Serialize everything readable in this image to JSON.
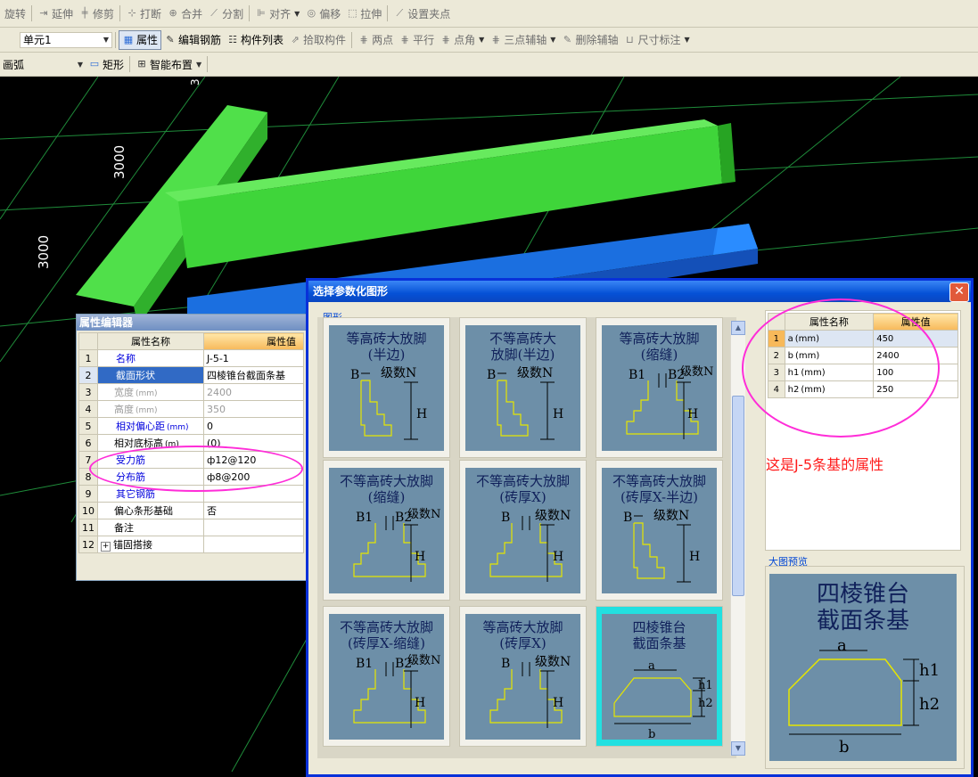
{
  "toolbar1": [
    {
      "label": "旋转",
      "icon": "rotate-icon"
    },
    {
      "label": "延伸",
      "icon": "extend-icon"
    },
    {
      "label": "修剪",
      "icon": "trim-icon"
    },
    {
      "label": "打断",
      "icon": "break-icon"
    },
    {
      "label": "合并",
      "icon": "merge-icon"
    },
    {
      "label": "分割",
      "icon": "split-icon"
    },
    {
      "label": "对齐",
      "icon": "align-icon"
    },
    {
      "label": "偏移",
      "icon": "offset-icon"
    },
    {
      "label": "拉伸",
      "icon": "stretch-icon"
    },
    {
      "label": "设置夹点",
      "icon": "grip-icon"
    }
  ],
  "toolbar2": {
    "unit_combo": "单元1",
    "items": [
      {
        "label": "属性",
        "icon": "properties-icon"
      },
      {
        "label": "编辑钢筋",
        "icon": "edit-rebar-icon"
      },
      {
        "label": "构件列表",
        "icon": "component-list-icon"
      },
      {
        "label": "拾取构件",
        "icon": "pick-component-icon"
      },
      {
        "label": "两点",
        "icon": "two-point-icon"
      },
      {
        "label": "平行",
        "icon": "parallel-icon"
      },
      {
        "label": "点角",
        "icon": "point-angle-icon"
      },
      {
        "label": "三点辅轴",
        "icon": "three-point-axis-icon"
      },
      {
        "label": "删除辅轴",
        "icon": "delete-axis-icon"
      },
      {
        "label": "尺寸标注",
        "icon": "dimension-icon"
      }
    ]
  },
  "toolbar3": {
    "arc_combo": "画弧",
    "rect": "矩形",
    "smart": "智能布置"
  },
  "scene": {
    "dim_top": "3000",
    "dim_left": "3000",
    "dim_edge": "3"
  },
  "prop_editor": {
    "title": "属性编辑器",
    "col_name": "属性名称",
    "col_value": "属性值",
    "rows": [
      {
        "n": "1",
        "name": "名称",
        "value": "J-5-1"
      },
      {
        "n": "2",
        "name": "截面形状",
        "value": "四棱锥台截面条基"
      },
      {
        "n": "3",
        "name": "宽度",
        "unit": "(mm)",
        "value": "2400"
      },
      {
        "n": "4",
        "name": "高度",
        "unit": "(mm)",
        "value": "350"
      },
      {
        "n": "5",
        "name": "相对偏心距",
        "unit": "(mm)",
        "value": "0"
      },
      {
        "n": "6",
        "name": "相对底标高",
        "unit": "(m)",
        "value": "(0)"
      },
      {
        "n": "7",
        "name": "受力筋",
        "value": "ф12@120"
      },
      {
        "n": "8",
        "name": "分布筋",
        "value": "ф8@200"
      },
      {
        "n": "9",
        "name": "其它钢筋",
        "value": ""
      },
      {
        "n": "10",
        "name": "偏心条形基础",
        "value": "否"
      },
      {
        "n": "11",
        "name": "备注",
        "value": ""
      },
      {
        "n": "12",
        "name": "锚固搭接",
        "value": "",
        "expand": "+"
      }
    ]
  },
  "dialog": {
    "title": "选择参数化图形",
    "close": "✕",
    "group_shapes": "图形",
    "group_preview": "大图预览",
    "annotation": "这是J-5条基的属性",
    "col_name": "属性名称",
    "col_value": "属性值",
    "params": [
      {
        "n": "1",
        "name": "a",
        "unit": "(mm)",
        "value": "450"
      },
      {
        "n": "2",
        "name": "b",
        "unit": "(mm)",
        "value": "2400"
      },
      {
        "n": "3",
        "name": "h1",
        "unit": "(mm)",
        "value": "100"
      },
      {
        "n": "4",
        "name": "h2",
        "unit": "(mm)",
        "value": "250"
      }
    ],
    "tiles": [
      {
        "title": "等高砖大放脚\n(半边)",
        "labels": [
          "B",
          "级数N",
          "H"
        ]
      },
      {
        "title": "不等高砖大\n放脚(半边)",
        "labels": [
          "B",
          "级数N",
          "H"
        ]
      },
      {
        "title": "等高砖大放脚\n(缩缝)",
        "labels": [
          "B1",
          "B2",
          "级数N",
          "H"
        ]
      },
      {
        "title": "不等高砖大放脚\n(缩缝)",
        "labels": [
          "B1",
          "B2",
          "级数N",
          "H"
        ]
      },
      {
        "title": "不等高砖大放脚\n(砖厚X)",
        "labels": [
          "B",
          "级数N",
          "H"
        ]
      },
      {
        "title": "不等高砖大放脚\n(砖厚X-半边)",
        "labels": [
          "B",
          "级数N",
          "H"
        ]
      },
      {
        "title": "不等高砖大放脚\n(砖厚X-缩缝)",
        "labels": [
          "B1",
          "B2",
          "级数N",
          "H"
        ]
      },
      {
        "title": "等高砖大放脚\n(砖厚X)",
        "labels": [
          "B",
          "级数N",
          "H"
        ]
      },
      {
        "title": "四棱锥台\n截面条基",
        "labels": [
          "a",
          "h1",
          "h2",
          "b"
        ]
      }
    ],
    "preview": {
      "title": "四棱锥台\n截面条基",
      "labels": [
        "a",
        "h1",
        "h2",
        "b"
      ]
    }
  },
  "colors": {
    "beam_green": "#3fd53a",
    "beam_blue": "#1b6fe0",
    "grid_green": "#1f8c3a",
    "highlight": "#ff2dd8",
    "annotation": "#ff1a1a"
  }
}
